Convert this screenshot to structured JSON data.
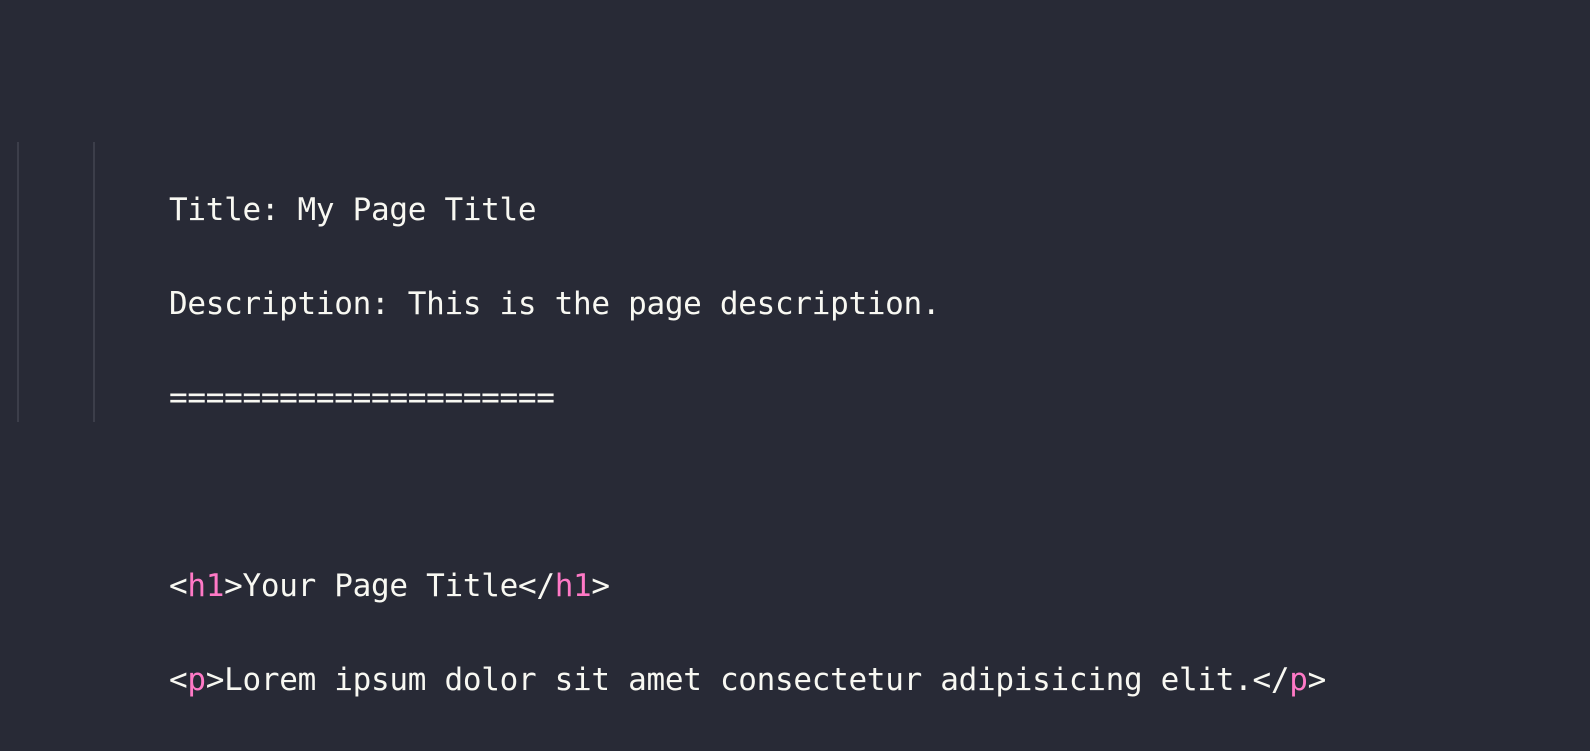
{
  "editor": {
    "lines": {
      "l1": "Title: My Page Title",
      "l2": "Description: This is the page description.",
      "l3": "=====================",
      "l4": "",
      "l5": {
        "open_lt": "<",
        "tag": "h1",
        "open_gt": ">",
        "text": "Your Page Title",
        "close_lt": "</",
        "close_tag": "h1",
        "close_gt": ">"
      },
      "l6": {
        "open_lt": "<",
        "tag": "p",
        "open_gt": ">",
        "text": "Lorem ipsum dolor sit amet consectetur adipisicing elit.",
        "close_lt": "</",
        "close_tag": "p",
        "close_gt": ">"
      }
    },
    "colors": {
      "background": "#282a36",
      "text": "#f8f8f2",
      "tag": "#ff79c6",
      "indent_guide": "#3c3e4a"
    }
  }
}
